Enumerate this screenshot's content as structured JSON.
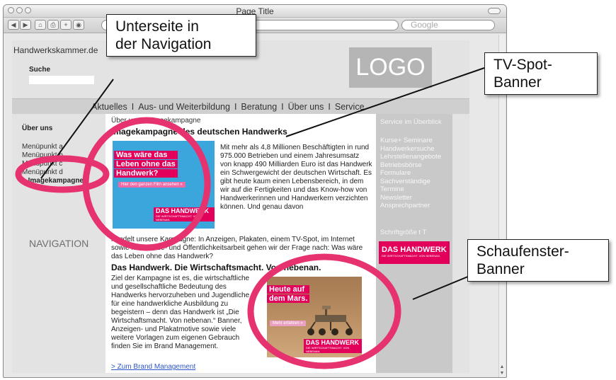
{
  "browser": {
    "window_title": "Page Title",
    "search_placeholder": "Google",
    "toolbar_buttons": [
      "◀",
      "▶",
      "⌂",
      "⎙",
      "+",
      "◉"
    ]
  },
  "site": {
    "site_title": "Handwerkskammer.de",
    "search_label": "Suche",
    "logo_text": "LOGO",
    "nav": [
      "Aktuelles",
      "Aus- und Weiterbildung",
      "Beratung",
      "Über uns",
      "Service"
    ],
    "nav_separator": "I"
  },
  "leftnav": {
    "heading": "Über uns",
    "items": [
      "Menüpunkt a",
      "Menüpunkt b",
      "Menüpunkt c",
      "Menüpunkt d"
    ],
    "active_item": "> Imagekampagne",
    "placeholder_label": "NAVIGATION"
  },
  "content": {
    "breadcrumb": "Über uns > Imagekampagne",
    "heading": "Imagekampagne des deutschen Handwerks",
    "tv_banner": {
      "headline_lines": [
        "Was wäre das",
        "Leben ohne das",
        "Handwerk?"
      ],
      "button": "Hier den ganzen Film ansehen »",
      "brand": "DAS HANDWERK",
      "brand_sub": "DIE WIRTSCHAFTSMACHT. VON NEBENAN."
    },
    "paragraph_1": "Mit mehr als 4,8 Millionen Beschäftigten in rund 975.000 Betrieben und einem Jahresumsatz von knapp 490 Milliarden Euro ist das Handwerk ein Schwergewicht der deutschen Wirtschaft. Es gibt heute kaum einen Lebensbereich, in dem wir auf die Fertigkeiten und das Know-how von Handwerkerinnen und Handwerkern verzichten können. Und genau davon",
    "paragraph_1_cont": "handelt unsere Kampagne: In Anzeigen, Plakaten, einem TV-Spot, im Internet sowie mit Presse- und Öffentlichkeitsarbeit gehen wir der Frage nach: Was wäre das Leben ohne das Handwerk?",
    "subheading": "Das Handwerk. Die Wirtschaftsmacht. Von nebenan.",
    "paragraph_2": "Ziel der Kampagne ist es, die wirtschaftliche und gesellschaftliche Bedeutung des Handwerks hervorzuheben und Jugendliche für eine handwerkliche Ausbildung zu begeistern – denn das Handwerk ist „Die Wirtschaftsmacht. Von nebenan.“ Banner, Anzeigen- und Plakatmotive sowie viele weitere Vorlagen zum eigenen Gebrauch finden Sie im Brand Management.",
    "link": "> Zum Brand Management",
    "mars_banner": {
      "headline_lines": [
        "Heute auf",
        "dem Mars."
      ],
      "button": "Mehr erfahren »",
      "brand": "DAS HANDWERK",
      "brand_sub": "DIE WIRTSCHAFTSMACHT. VON NEBENAN."
    }
  },
  "rightcol": {
    "heading": "Service im Überblick",
    "items": [
      "Kurse+ Seminare",
      "Handwerkersuche",
      "Lehrstellenangebote",
      "Betriebsbörse",
      "Formulare",
      "Sachverständige",
      "Termine",
      "Newsletter",
      "Ansprechpartner"
    ],
    "font_size_label": "Schriftgröße t T",
    "brand": "DAS HANDWERK",
    "brand_sub": "DIE WIRTSCHAFTSMACHT. VON NEBENAN."
  },
  "annotations": {
    "nav_callout": [
      "Unterseite in",
      "der Navigation"
    ],
    "tv_callout": [
      "TV-Spot-",
      "Banner"
    ],
    "shop_callout": [
      "Schaufenster-",
      "Banner"
    ]
  },
  "colors": {
    "brand_magenta": "#e2005a",
    "ring_pink": "#e6336f",
    "tv_banner_blue": "#3aa6dc",
    "page_gray": "#e3e3e3",
    "right_column_gray": "#c9c9c9"
  }
}
